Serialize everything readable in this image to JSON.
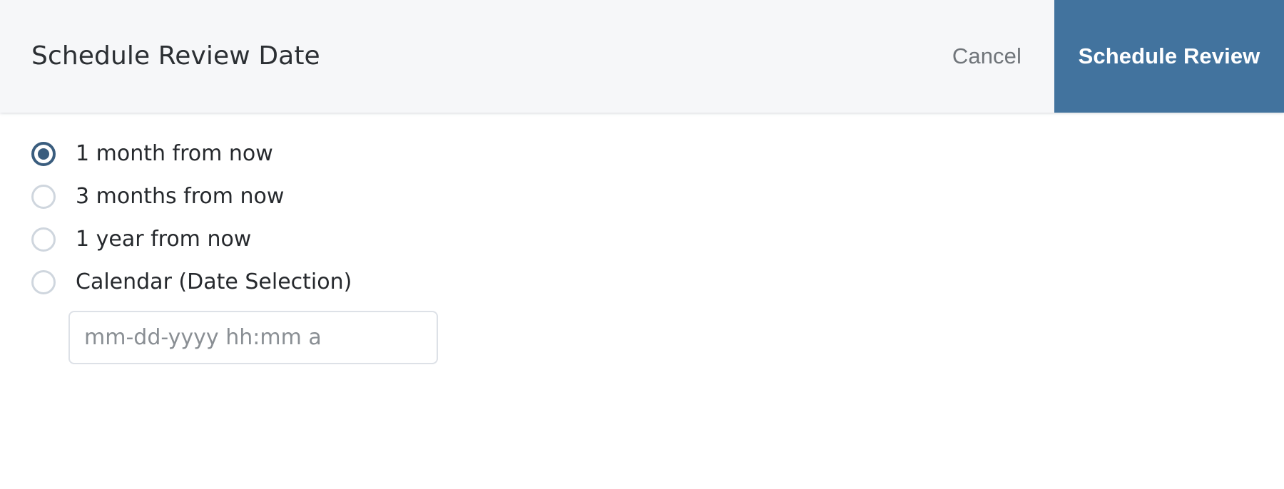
{
  "header": {
    "title": "Schedule Review Date",
    "cancel_label": "Cancel",
    "primary_label": "Schedule Review",
    "background_color": "#f6f7f9",
    "primary_color": "#42739e",
    "cancel_text_color": "#70757a"
  },
  "form": {
    "options": [
      {
        "label": "1 month from now",
        "selected": true
      },
      {
        "label": "3 months from now",
        "selected": false
      },
      {
        "label": "1 year from now",
        "selected": false
      },
      {
        "label": "Calendar (Date Selection)",
        "selected": false
      }
    ],
    "date_input": {
      "value": "",
      "placeholder": "mm-dd-yyyy hh:mm a"
    },
    "selected_radio_color": "#3a5d7e",
    "unselected_radio_color": "#cfd6de"
  }
}
